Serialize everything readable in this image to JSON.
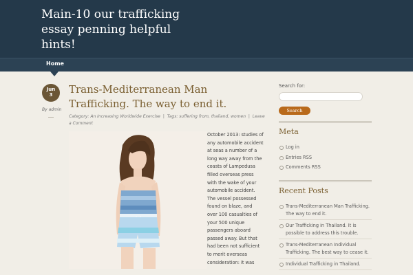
{
  "header": {
    "site_title": "Main-10 our trafficking essay penning helpful hints!"
  },
  "nav": {
    "home_label": "Home"
  },
  "post": {
    "date_month": "Jun",
    "date_day": "3",
    "author_prefix": "By",
    "author": "admin",
    "title": "Trans-Mediterranean Man Trafficking. The way to end it.",
    "category_label": "Category:",
    "category": "An Increasing Worldwide Exercise",
    "tags_label": "Tags:",
    "tags": [
      "suffering from",
      "thailand",
      "women"
    ],
    "leave_comment": "Leave a Comment",
    "body_text": "October 2013: studies of any automobile accident at seas a number of a long way away from the coasts of Lampedusa filled overseas press with the wake of your automobile accident. The vessel possessed found on blaze, and over 100 casualties of your 500 unique passengers aboard passed away. But that had been not sufficient to merit overseas consideration: it was"
  },
  "sidebar": {
    "search_label": "Search for:",
    "search_value": "",
    "search_button": "Search",
    "meta_title": "Meta",
    "meta_items": [
      "Log in",
      "Entries RSS",
      "Comments RSS"
    ],
    "recent_title": "Recent Posts",
    "recent_items": [
      "Trans-Mediterranean Man Trafficking. The way to end it.",
      "Our Trafficking in Thailand. It is possible to address this trouble.",
      "Trans-Mediterranean Individual Trafficking. The best way to cease it.",
      "Individual Trafficking in Thailand."
    ]
  }
}
